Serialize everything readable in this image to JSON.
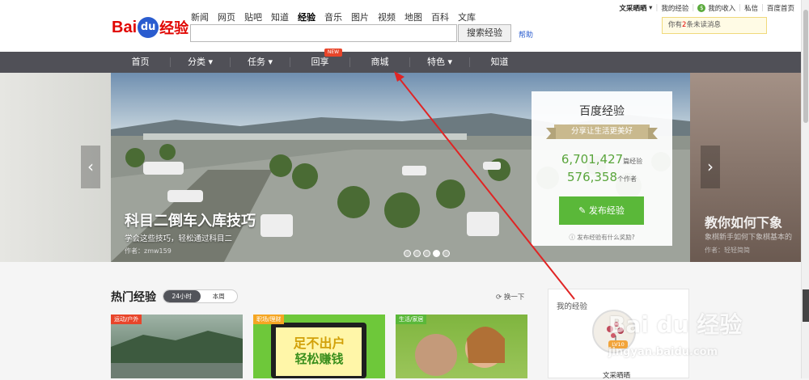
{
  "logo": {
    "bai": "Bai",
    "du": "du",
    "jingyan": "经验"
  },
  "product_nav": [
    "新闻",
    "网页",
    "贴吧",
    "知道",
    "经验",
    "音乐",
    "图片",
    "视频",
    "地图",
    "百科",
    "文库"
  ],
  "product_nav_active": 4,
  "search": {
    "value": "",
    "button": "搜索经验",
    "help": "帮助"
  },
  "user": {
    "name": "文采晒晒",
    "my_jingyan": "我的经验",
    "income": "我的收入",
    "pm": "私信",
    "home": "百度首页"
  },
  "msg": {
    "prefix": "你有",
    "count": "2",
    "suffix": "条未读消息"
  },
  "main_nav": [
    {
      "label": "首页"
    },
    {
      "label": "分类 ▾"
    },
    {
      "label": "任务 ▾"
    },
    {
      "label": "回享"
    },
    {
      "label": "商城"
    },
    {
      "label": "特色 ▾"
    },
    {
      "label": "知道"
    }
  ],
  "new_tag": "NEW",
  "banner": {
    "title": "科目二倒车入库技巧",
    "subtitle": "学会这些技巧，轻松通过科目二",
    "author": "作者：zmw159",
    "side_title": "教你如何下象",
    "side_sub": "象棋新手如何下象棋基本的",
    "side_author": "作者：轻轻简简"
  },
  "panel": {
    "title": "百度经验",
    "slogan": "分享让生活更美好",
    "count1": "6,701,427",
    "unit1": "篇经验",
    "count2": "576,358",
    "unit2": "个作者",
    "publish": "发布经验",
    "reward": "发布经验有什么奖励?"
  },
  "hot": {
    "title": "热门经验",
    "tabs": [
      "24小时",
      "本周"
    ],
    "refresh": "换一下"
  },
  "cards": [
    {
      "tag": "运动/户外",
      "tag_color": "#e8452a"
    },
    {
      "tag": "职场/理财",
      "tag_color": "#f5a623",
      "text1": "足不出户",
      "text2": "轻松赚钱"
    },
    {
      "tag": "生活/家居",
      "tag_color": "#5ab839"
    }
  ],
  "my_jingyan": {
    "title": "我的经验",
    "level": "LV10",
    "user": "文采晒晒"
  },
  "watermark": {
    "brand": "Bai du 经验",
    "url": "jingyan.baidu.com"
  }
}
